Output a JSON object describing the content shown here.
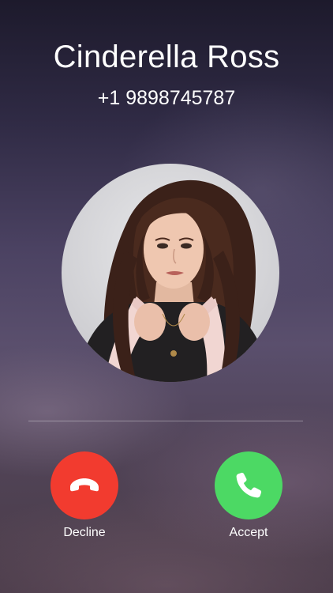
{
  "caller": {
    "name": "Cinderella Ross",
    "number": "+1 9898745787"
  },
  "actions": {
    "decline_label": "Decline",
    "accept_label": "Accept"
  },
  "icons": {
    "decline": "phone-hangup-icon",
    "accept": "phone-icon"
  },
  "colors": {
    "decline": "#f23b2f",
    "accept": "#4cd964",
    "text": "#ffffff"
  }
}
